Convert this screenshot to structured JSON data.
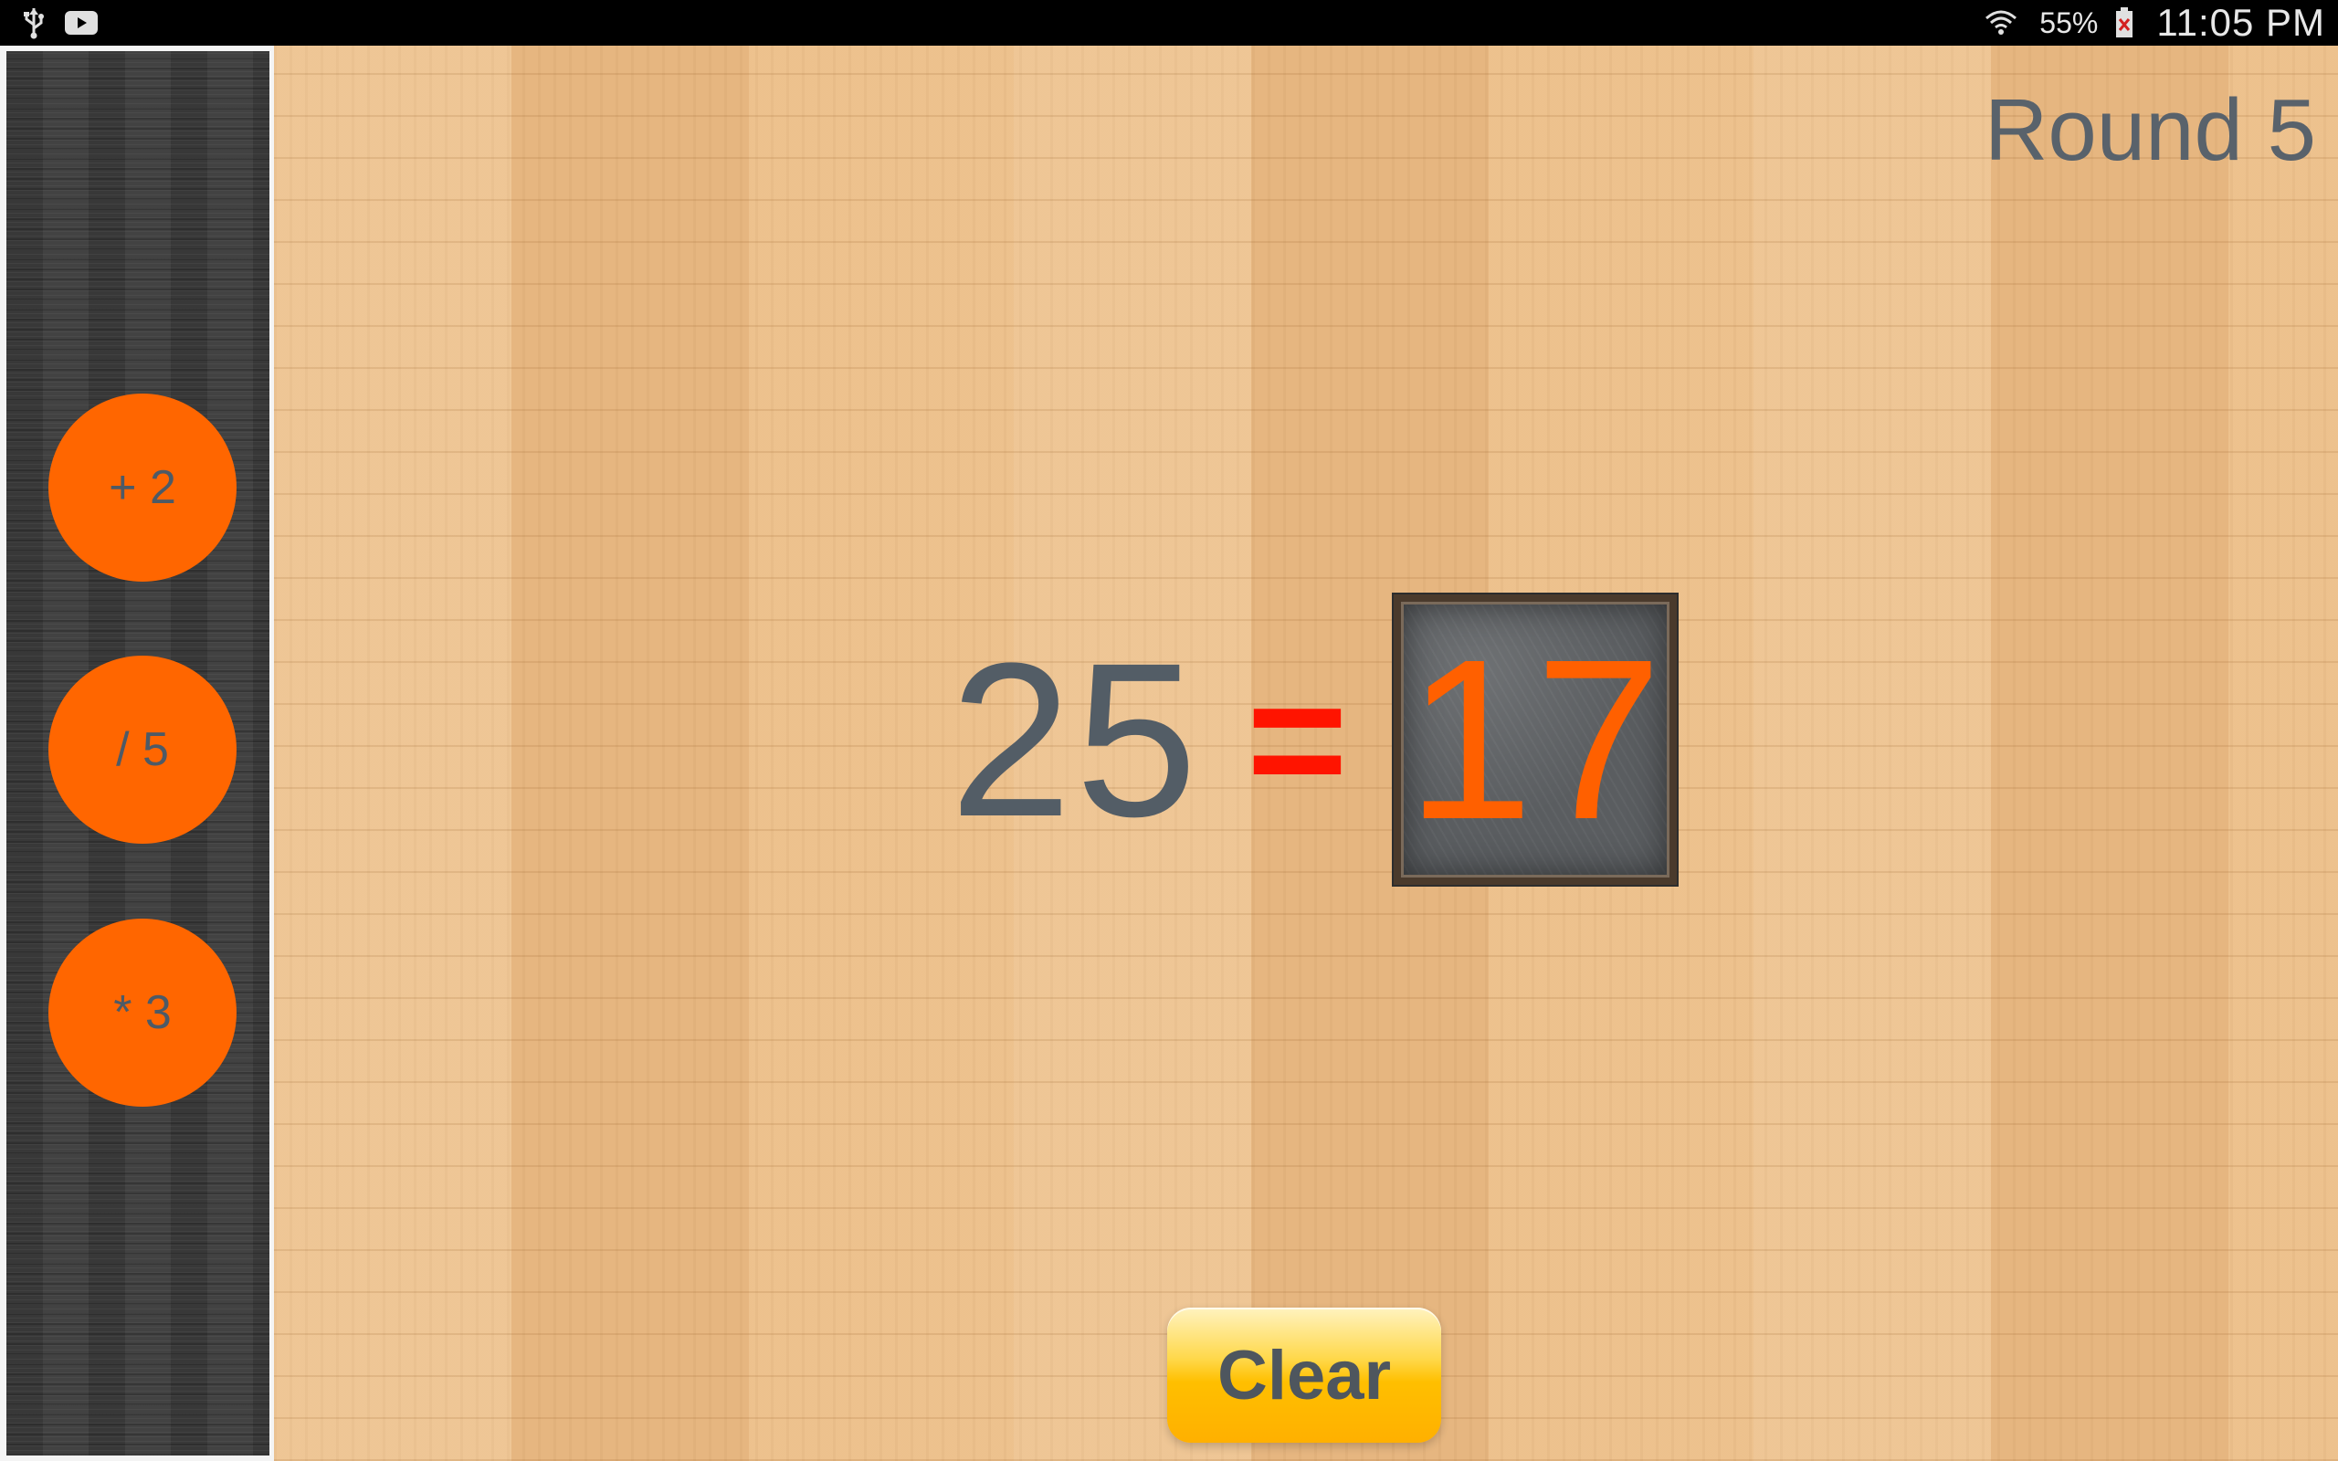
{
  "status_bar": {
    "left_icons": [
      "usb-icon",
      "youtube-icon"
    ],
    "right_icons": [
      "wifi-icon",
      "battery-icon"
    ],
    "battery": "55%",
    "time": "11:05 PM"
  },
  "sidebar": {
    "operations": [
      {
        "label": "+ 2"
      },
      {
        "label": "/ 5"
      },
      {
        "label": "* 3"
      }
    ]
  },
  "game": {
    "round": "Round 5",
    "start_number": "25",
    "equals": "=",
    "target_number": "17",
    "clear_label": "Clear"
  },
  "colors": {
    "operation_button": "#ff6600",
    "equals_sign": "#ff1400",
    "target_number": "#ff6000",
    "clear_button": "#ffbf00",
    "text_gray": "#535d66"
  }
}
